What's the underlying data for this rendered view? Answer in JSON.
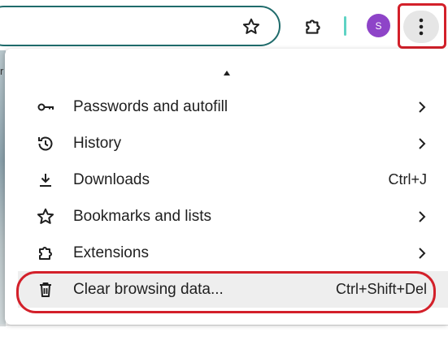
{
  "toolbar": {
    "avatar_initial": "S"
  },
  "page": {
    "fragment_text": "r"
  },
  "menu": {
    "items": [
      {
        "label": "Passwords and autofill",
        "shortcut": "",
        "has_submenu": true,
        "icon": "key-icon"
      },
      {
        "label": "History",
        "shortcut": "",
        "has_submenu": true,
        "icon": "history-icon"
      },
      {
        "label": "Downloads",
        "shortcut": "Ctrl+J",
        "has_submenu": false,
        "icon": "download-icon"
      },
      {
        "label": "Bookmarks and lists",
        "shortcut": "",
        "has_submenu": true,
        "icon": "star-icon"
      },
      {
        "label": "Extensions",
        "shortcut": "",
        "has_submenu": true,
        "icon": "puzzle-icon"
      },
      {
        "label": "Clear browsing data...",
        "shortcut": "Ctrl+Shift+Del",
        "has_submenu": false,
        "icon": "trash-icon"
      }
    ]
  },
  "colors": {
    "annotation_red": "#d3202a",
    "avatar_purple": "#8e44c8",
    "omnibox_border": "#1f6b6b"
  }
}
